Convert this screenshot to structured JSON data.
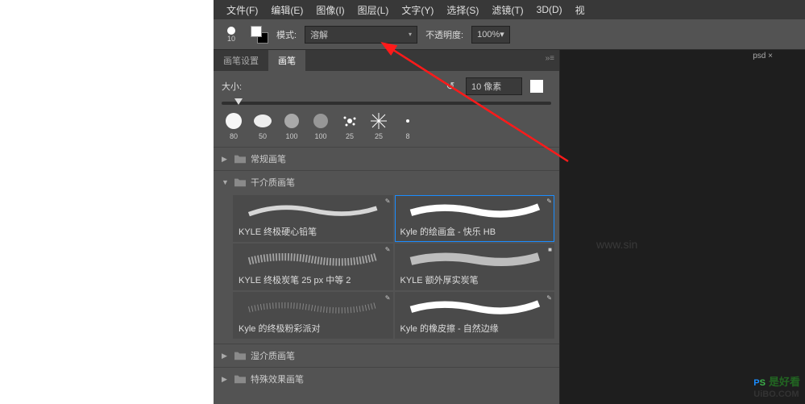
{
  "menu": {
    "items": [
      "文件(F)",
      "编辑(E)",
      "图像(I)",
      "图层(L)",
      "文字(Y)",
      "选择(S)",
      "滤镜(T)",
      "3D(D)",
      "视"
    ]
  },
  "optbar": {
    "brush_size": "10",
    "mode_label": "模式:",
    "mode_value": "溶解",
    "opacity_label": "不透明度:",
    "opacity_value": "100%"
  },
  "panel": {
    "tabs": {
      "settings": "画笔设置",
      "brushes": "画笔"
    },
    "size_label": "大小:",
    "size_value": "10 像素",
    "stamps": [
      {
        "size": "80"
      },
      {
        "size": "50"
      },
      {
        "size": "100"
      },
      {
        "size": "100"
      },
      {
        "size": "25"
      },
      {
        "size": "25"
      },
      {
        "size": "8"
      }
    ],
    "folders": {
      "regular": "常规画笔",
      "dry": "干介质画笔",
      "wet": "湿介质画笔",
      "special": "特殊效果画笔"
    },
    "dry_brushes": [
      {
        "name": "KYLE 终极硬心铅笔"
      },
      {
        "name": "Kyle 的绘画盒 - 快乐 HB"
      },
      {
        "name": "KYLE 终极炭笔 25 px 中等 2"
      },
      {
        "name": "KYLE 额外厚实炭笔"
      },
      {
        "name": "Kyle 的终极粉彩派对"
      },
      {
        "name": "Kyle 的橡皮擦 - 自然边缘"
      }
    ]
  },
  "doc": {
    "tab_suffix": "psd ×"
  },
  "watermark": {
    "faint": "www.sin",
    "brand_p": "P",
    "brand_s": "S",
    "brand_cn": "是好看",
    "brand_ext": "UiBO.COM"
  }
}
